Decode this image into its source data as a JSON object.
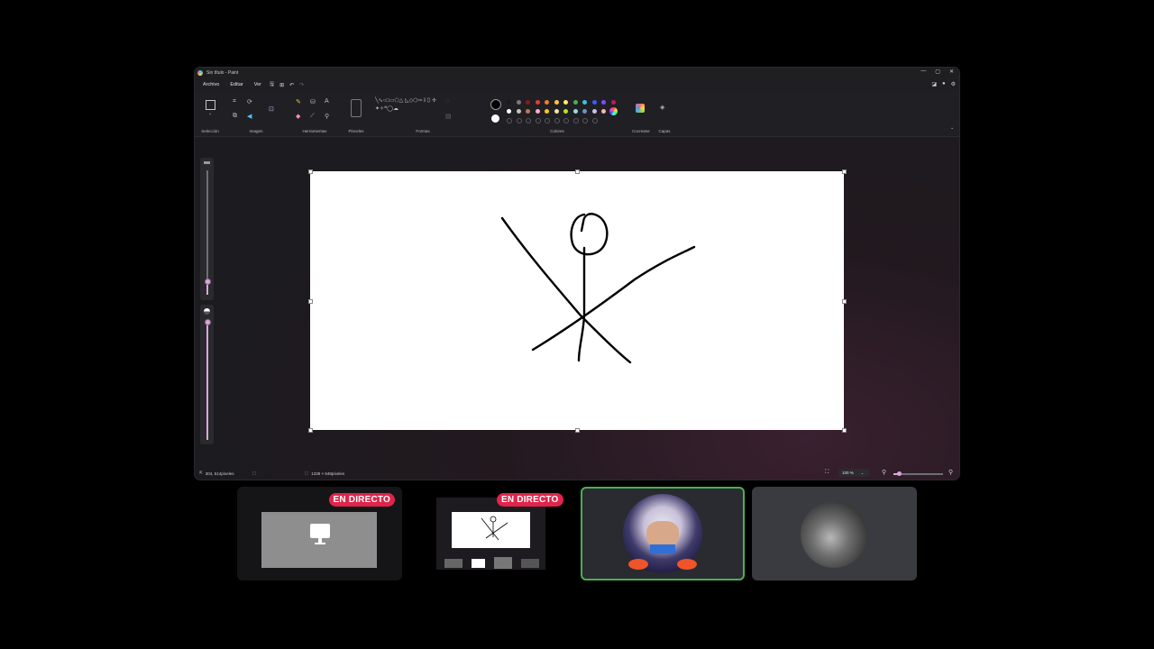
{
  "window": {
    "title": "Sin título - Paint",
    "controls": [
      "—",
      "▢",
      "✕"
    ]
  },
  "menu": {
    "items": [
      "Archivo",
      "Editar",
      "Ver"
    ],
    "quick_icons": [
      "save-icon",
      "new-icon",
      "undo-icon",
      "redo-icon"
    ],
    "right_icons": [
      "share-icon",
      "account-icon",
      "settings-icon"
    ]
  },
  "ribbon": {
    "groups": {
      "selection": "Selección",
      "image": "Imagen",
      "tools": "Herramientas",
      "brushes": "Pinceles",
      "shapes": "Formas",
      "colors": "Colores",
      "cocreator": "Cocreator",
      "layers": "Capas"
    },
    "shape_glyphs": "╲∿○□▭⬠△ ◺◇⬡⇨⇩⬯ ✢✦✧❝◯☁",
    "palette_row1": [
      "#1a1a1a",
      "#7a7a7a",
      "#8b1a1a",
      "#e23b3b",
      "#f47b2f",
      "#ffc83d",
      "#f9ef6a",
      "#4caf50",
      "#3ac1e6",
      "#3d5afe",
      "#7c4dff",
      "#c2185b"
    ],
    "palette_row2": [
      "#ffffff",
      "#c3c3c3",
      "#b97a57",
      "#ffaec9",
      "#ffc90e",
      "#efe4b0",
      "#b5e61d",
      "#99d9ea",
      "#7092be",
      "#c8bfe7",
      "#ffb3b3",
      "#e0e0e0"
    ],
    "primary_color": "#000000",
    "secondary_color": "#ffffff"
  },
  "status": {
    "cursor": "304, 514píxeles",
    "canvas_size": "1339 × 648píxeles",
    "zoom": "100 %",
    "zoom_fraction": 0.1
  },
  "stream_tiles": {
    "badge_1": "EN DIRECTO",
    "badge_2": "EN DIRECTO"
  },
  "colors": {
    "live_badge": "#e0244b",
    "selected_tile_border": "#4caf50",
    "slider_accent": "#d9a7d8"
  }
}
